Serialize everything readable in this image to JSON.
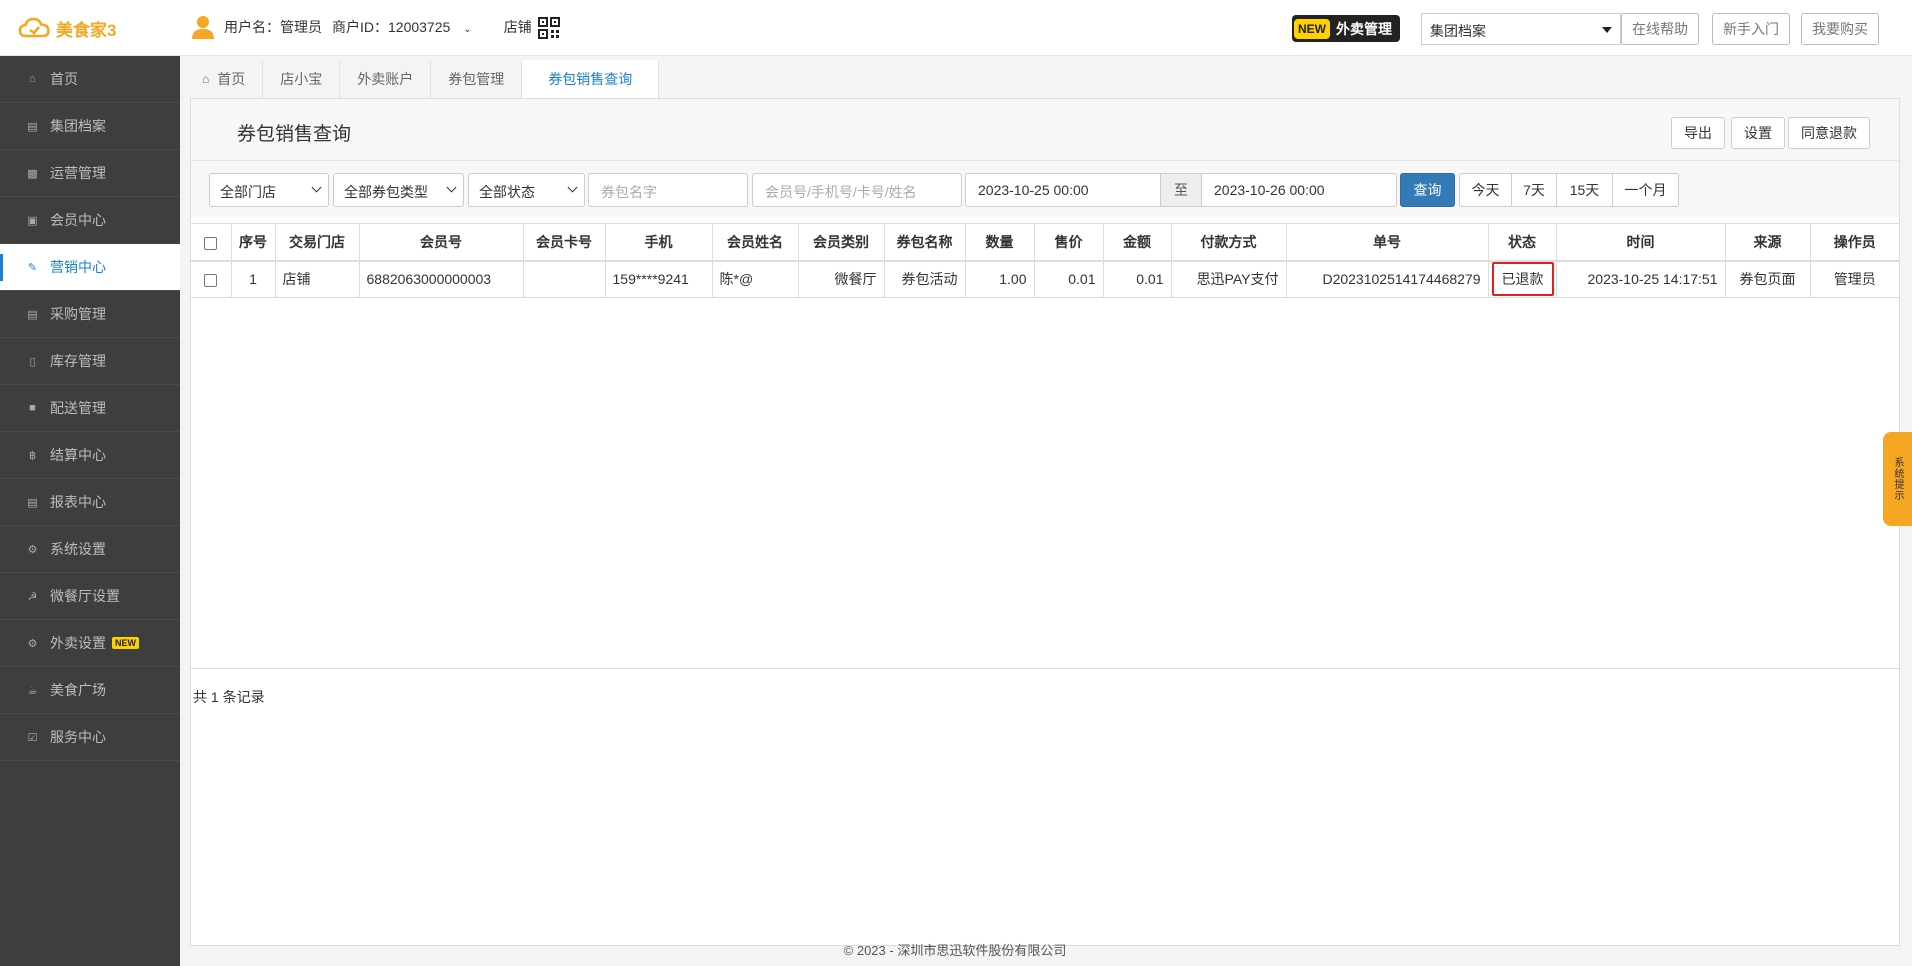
{
  "app": {
    "logo_text": "美食家3"
  },
  "header": {
    "username_label": "用户名：管理员",
    "merchant_label": "商户ID：12003725",
    "store_label": "店铺",
    "new_tag": "NEW",
    "takeout_label": "外卖管理",
    "archive_select_value": "集团档案",
    "help_button": "在线帮助",
    "guide_button": "新手入门",
    "buy_button": "我要购买"
  },
  "sidebar": {
    "items": [
      {
        "label": "首页",
        "icon": "home-icon"
      },
      {
        "label": "集团档案",
        "icon": "file-icon"
      },
      {
        "label": "运营管理",
        "icon": "bar-chart-icon"
      },
      {
        "label": "会员中心",
        "icon": "id-card-icon"
      },
      {
        "label": "营销中心",
        "icon": "edit-icon",
        "active": true
      },
      {
        "label": "采购管理",
        "icon": "book-icon"
      },
      {
        "label": "库存管理",
        "icon": "document-icon"
      },
      {
        "label": "配送管理",
        "icon": "truck-icon"
      },
      {
        "label": "结算中心",
        "icon": "bitcoin-icon"
      },
      {
        "label": "报表中心",
        "icon": "report-icon"
      },
      {
        "label": "系统设置",
        "icon": "gears-icon"
      },
      {
        "label": "微餐厅设置",
        "icon": "cutlery-icon"
      },
      {
        "label": "外卖设置",
        "icon": "gear-icon",
        "badge": "NEW"
      },
      {
        "label": "美食广场",
        "icon": "coffee-icon"
      },
      {
        "label": "服务中心",
        "icon": "check-square-icon"
      }
    ]
  },
  "tabs": [
    {
      "label": "首页"
    },
    {
      "label": "店小宝"
    },
    {
      "label": "外卖账户"
    },
    {
      "label": "券包管理"
    },
    {
      "label": "券包销售查询",
      "active": true
    }
  ],
  "panel": {
    "title": "券包销售查询",
    "export_button": "导出",
    "settings_button": "设置",
    "refund_button": "同意退款"
  },
  "filters": {
    "store_select": "全部门店",
    "type_select": "全部券包类型",
    "status_select": "全部状态",
    "package_name_placeholder": "券包名字",
    "member_placeholder": "会员号/手机号/卡号/姓名",
    "date_from": "2023-10-25 00:00",
    "to_label": "至",
    "date_to": "2023-10-26 00:00",
    "query_button": "查询",
    "ranges": [
      "今天",
      "7天",
      "15天",
      "一个月"
    ]
  },
  "table": {
    "columns": [
      "序号",
      "交易门店",
      "会员号",
      "会员卡号",
      "手机",
      "会员姓名",
      "会员类别",
      "券包名称",
      "数量",
      "售价",
      "金额",
      "付款方式",
      "单号",
      "状态",
      "时间",
      "来源",
      "操作员"
    ],
    "rows": [
      [
        "1",
        "店铺",
        "6882063000000003",
        "",
        "159****9241",
        "陈*@",
        "微餐厅",
        "券包活动",
        "1.00",
        "0.01",
        "0.01",
        "思迅PAY支付",
        "D2023102514174468279",
        "已退款",
        "2023-10-25 14:17:51",
        "券包页面",
        "管理员"
      ]
    ]
  },
  "records_text": "共 1 条记录",
  "footer_text": "© 2023 - 深圳市思迅软件股份有限公司",
  "float_tip": "系统提示",
  "colors": {
    "accent": "#1b7fd6",
    "brand": "#f5a623",
    "sidebar_bg": "#3e3e3e",
    "primary_button": "#337ab7",
    "highlight": "#e02020"
  }
}
